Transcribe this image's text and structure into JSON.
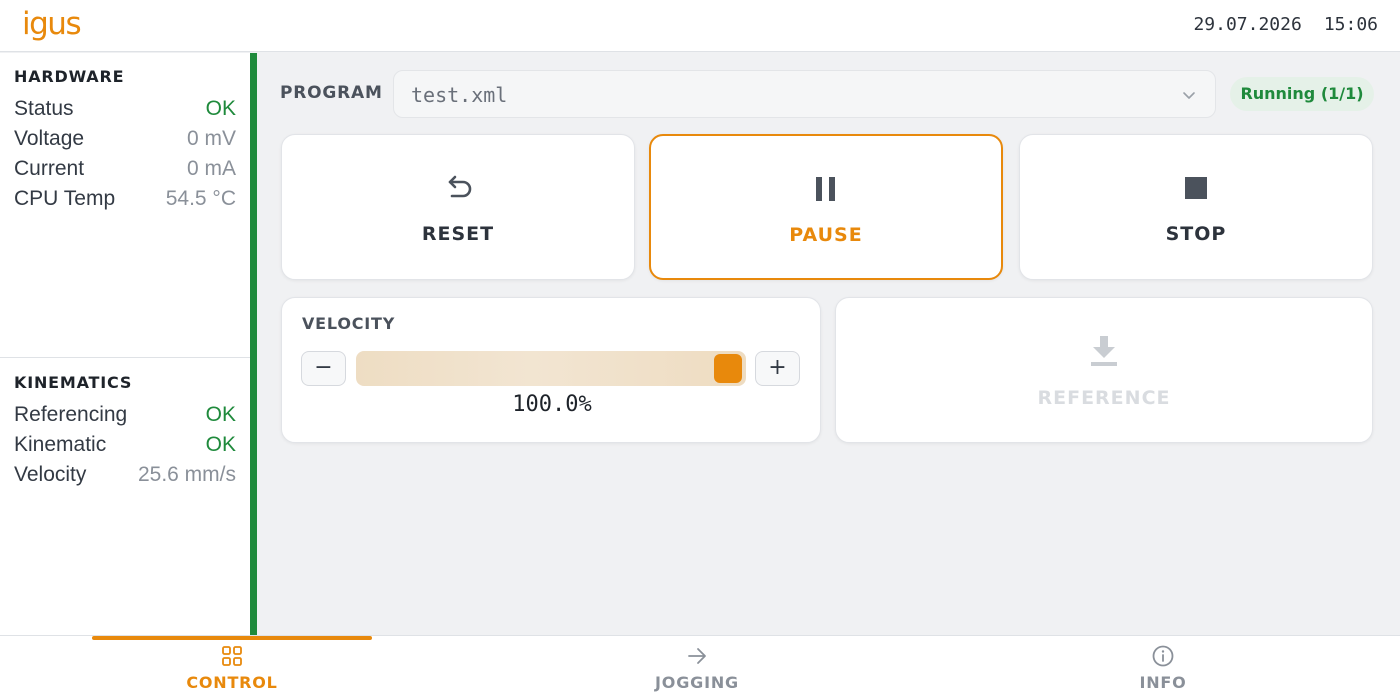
{
  "header": {
    "logo_text": "igus",
    "date": "29.07.2026",
    "time": "15:06"
  },
  "sidebar": {
    "hardware": {
      "title": "HARDWARE",
      "rows": [
        {
          "label": "Status",
          "value": "OK"
        },
        {
          "label": "Voltage",
          "value": "0 mV"
        },
        {
          "label": "Current",
          "value": "0 mA"
        },
        {
          "label": "CPU Temp",
          "value": "54.5 °C"
        }
      ]
    },
    "kinematics": {
      "title": "KINEMATICS",
      "rows": [
        {
          "label": "Referencing",
          "value": "OK"
        },
        {
          "label": "Kinematic",
          "value": "OK"
        },
        {
          "label": "Velocity",
          "value": "25.6 mm/s"
        }
      ]
    }
  },
  "program": {
    "label": "PROGRAM",
    "selected": "test.xml",
    "status": "Running (1/1)"
  },
  "controls": {
    "reset_label": "RESET",
    "pause_label": "PAUSE",
    "stop_label": "STOP"
  },
  "velocity": {
    "title": "VELOCITY",
    "minus": "−",
    "plus": "+",
    "value_text": "100.0%",
    "level_percent": 100
  },
  "reference": {
    "label": "REFERENCE"
  },
  "tabs": [
    {
      "label": "CONTROL",
      "icon": "grid-icon",
      "active": true
    },
    {
      "label": "JOGGING",
      "icon": "arrow-right-icon",
      "active": false
    },
    {
      "label": "INFO",
      "icon": "info-icon",
      "active": false
    }
  ],
  "colors": {
    "accent": "#e8890c",
    "ok": "#1f8a3c",
    "status_pill_bg": "#e5f1e8"
  }
}
